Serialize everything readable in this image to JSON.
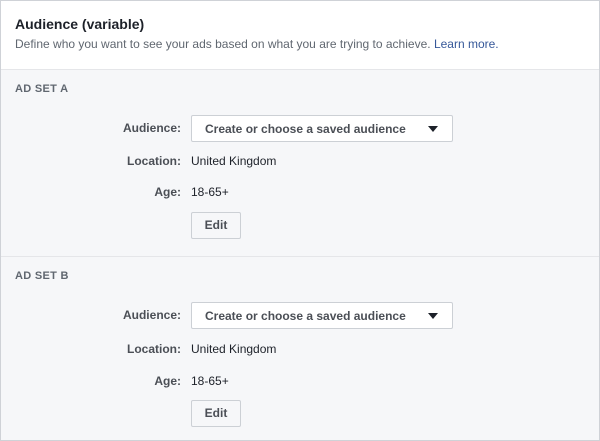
{
  "header": {
    "title": "Audience (variable)",
    "description": "Define who you want to see your ads based on what you are trying to achieve.",
    "learn_more": "Learn more."
  },
  "ad_sets": [
    {
      "title": "AD SET A",
      "audience_label": "Audience:",
      "audience_dropdown": "Create or choose a saved audience",
      "location_label": "Location:",
      "location_value": "United Kingdom",
      "age_label": "Age:",
      "age_value": "18-65+",
      "edit_label": "Edit"
    },
    {
      "title": "AD SET B",
      "audience_label": "Audience:",
      "audience_dropdown": "Create or choose a saved audience",
      "location_label": "Location:",
      "location_value": "United Kingdom",
      "age_label": "Age:",
      "age_value": "18-65+",
      "edit_label": "Edit"
    }
  ],
  "colors": {
    "link": "#365899",
    "section_background": "#f6f7f9",
    "border": "#ccd0d5"
  },
  "icons": {
    "dropdown_caret": "caret-down-icon"
  }
}
